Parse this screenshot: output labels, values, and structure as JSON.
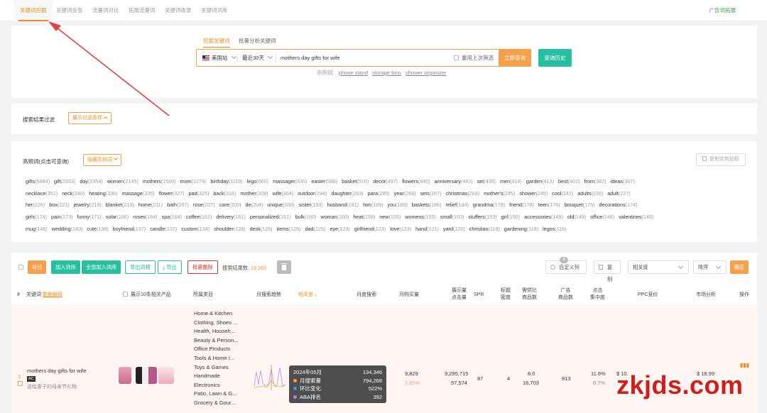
{
  "nav": {
    "tabs": [
      "关键词挖掘",
      "关键词反查",
      "流量词对比",
      "拓展流量词",
      "关键词收录",
      "关键词词库"
    ],
    "right_link": "广告词拓展"
  },
  "search": {
    "tabs": [
      "挖掘关键词",
      "批量分析关键词"
    ],
    "site": "美国站",
    "period": "最近30天",
    "query": "mothers day gifts for wife",
    "reuse_label": "重用上次筛选",
    "submit_label": "立即查询",
    "history_label": "查询历史",
    "examples_label": "示例词:",
    "examples": [
      "phone stand",
      "storage bins",
      "shower organizer"
    ]
  },
  "filter": {
    "title": "搜索结果过滤",
    "toggle_label": "展示过滤条件"
  },
  "keywords": {
    "title": "高频词(点击可查询)",
    "toggle_label": "隐藏高频词",
    "copy_label": "复制到剪贴板",
    "rows": [
      [
        [
          "gifts",
          "5684"
        ],
        [
          "gift",
          "2553"
        ],
        [
          "day",
          "2354"
        ],
        [
          "women",
          "2145"
        ],
        [
          "mothers",
          "1560"
        ],
        [
          "mom",
          "1279"
        ],
        [
          "birthday",
          "1119"
        ],
        [
          "lego",
          "660"
        ],
        [
          "massager",
          "635"
        ],
        [
          "easter",
          "588"
        ],
        [
          "basket",
          "516"
        ],
        [
          "decor",
          "497"
        ],
        [
          "flowers",
          "485"
        ],
        [
          "anniversary",
          "483"
        ],
        [
          "set",
          "439"
        ],
        [
          "men",
          "414"
        ],
        [
          "garden",
          "413"
        ],
        [
          "best",
          "402"
        ],
        [
          "from",
          "382"
        ],
        [
          "ideas",
          "367"
        ]
      ],
      [
        [
          "necklace",
          "351"
        ],
        [
          "neck",
          "340"
        ],
        [
          "heating",
          "336"
        ],
        [
          "massage",
          "335"
        ],
        [
          "flower",
          "327"
        ],
        [
          "pad",
          "325"
        ],
        [
          "back",
          "316"
        ],
        [
          "mother",
          "309"
        ],
        [
          "wife",
          "304"
        ],
        [
          "outdoor",
          "294"
        ],
        [
          "daughter",
          "293"
        ],
        [
          "para",
          "285"
        ],
        [
          "year",
          "269"
        ],
        [
          "sets",
          "267"
        ],
        [
          "christmas",
          "264"
        ],
        [
          "mother's",
          "245"
        ],
        [
          "shower",
          "245"
        ],
        [
          "cool",
          "242"
        ],
        [
          "adults",
          "230"
        ],
        [
          "adult",
          "227"
        ]
      ],
      [
        [
          "her",
          "225"
        ],
        [
          "box",
          "221"
        ],
        [
          "jewelry",
          "219"
        ],
        [
          "blanket",
          "213"
        ],
        [
          "home",
          "211"
        ],
        [
          "bath",
          "207"
        ],
        [
          "rose",
          "207"
        ],
        [
          "care",
          "205"
        ],
        [
          "de",
          "204"
        ],
        [
          "unique",
          "200"
        ],
        [
          "sister",
          "193"
        ],
        [
          "husband",
          "191"
        ],
        [
          "him",
          "189"
        ],
        [
          "you",
          "189"
        ],
        [
          "baskets",
          "186"
        ],
        [
          "relief",
          "184"
        ],
        [
          "grandma",
          "179"
        ],
        [
          "friend",
          "178"
        ],
        [
          "teen",
          "176"
        ],
        [
          "bouquet",
          "175"
        ],
        [
          "decorations",
          "174"
        ]
      ],
      [
        [
          "girls",
          "174"
        ],
        [
          "pain",
          "173"
        ],
        [
          "funny",
          "171"
        ],
        [
          "solar",
          "166"
        ],
        [
          "roses",
          "164"
        ],
        [
          "spa",
          "164"
        ],
        [
          "coffee",
          "161"
        ],
        [
          "delivery",
          "161"
        ],
        [
          "personalized",
          "161"
        ],
        [
          "bulk",
          "160"
        ],
        [
          "woman",
          "160"
        ],
        [
          "heat",
          "158"
        ],
        [
          "new",
          "155"
        ],
        [
          "womens",
          "155"
        ],
        [
          "small",
          "153"
        ],
        [
          "stuffers",
          "153"
        ],
        [
          "girl",
          "150"
        ],
        [
          "accessories",
          "149"
        ],
        [
          "old",
          "149"
        ],
        [
          "office",
          "148"
        ],
        [
          "valentines",
          "148"
        ]
      ],
      [
        [
          "mug",
          "146"
        ],
        [
          "wedding",
          "140"
        ],
        [
          "cute",
          "138"
        ],
        [
          "boyfriend",
          "137"
        ],
        [
          "candle",
          "137"
        ],
        [
          "custom",
          "134"
        ],
        [
          "shoulder",
          "128"
        ],
        [
          "desk",
          "126"
        ],
        [
          "items",
          "126"
        ],
        [
          "dad",
          "125"
        ],
        [
          "eye",
          "123"
        ],
        [
          "girlfriend",
          "123"
        ],
        [
          "love",
          "123"
        ],
        [
          "hand",
          "121"
        ],
        [
          "yard",
          "120"
        ],
        [
          "christian",
          "119"
        ],
        [
          "gardening",
          "118"
        ],
        [
          "legos",
          "116"
        ]
      ]
    ]
  },
  "results": {
    "toolbar": {
      "compare": "对比",
      "add": "加入词库",
      "add_all": "全部加入词库",
      "export_root": "导出词根",
      "export": "导出",
      "batch_delete": "批量删除",
      "count_label": "搜索结果数:",
      "count": "19,165",
      "custom_cols": "自定义列",
      "custom_badge": "4",
      "copy": "复制",
      "sort_field": "相关度",
      "sort_order": "降序",
      "confirm": "确定"
    },
    "headers": {
      "no": "#",
      "keyword": "关键词",
      "data_explain": "数据解释",
      "show_products": "展示10条相关产品",
      "category": "所属类目",
      "trend": "月搜索趋势",
      "relevance": "相关度",
      "monthly_search": "月度搜索",
      "monthly_buy": "月购买量",
      "impressions": "展示量",
      "clicks": "点击量",
      "spr": "SPR",
      "title_density1": "标题",
      "title_density2": "密度",
      "supply1": "需供比",
      "supply2": "商品数",
      "ad1": "广告",
      "ad2": "商品数",
      "click1": "点击",
      "click2": "集中度",
      "ppc": "PPC竞价",
      "market": "市场分析",
      "action": "操作"
    },
    "row": {
      "no": "1",
      "keyword": "mothers day gifts for wife",
      "ac_badge": "AC",
      "translation": "送给妻子的母亲节礼物",
      "categories": [
        "Home & Kitchen",
        "Clothing, Shoes ...",
        "Health, Househ...",
        "Beauty & Person...",
        "Office Products",
        "Tools & Home I...",
        "Toys & Games",
        "Handmade",
        "Electronics",
        "Patio, Lawn & G...",
        "Grocery & Gour..."
      ],
      "buy": "3,829",
      "buy_rate": "2.85%",
      "impressions": "3,295,715",
      "clicks": "57,574",
      "spr": "87",
      "title_density": "4",
      "supply_ratio": "8.0",
      "supply_products": "16,703",
      "ad_products": "813",
      "click_conc": "11.6%",
      "click_conc2": "6.7%",
      "ppc": "$ 10.",
      "market_price": "$ 18.99"
    },
    "tooltip": {
      "date": "2024年05月",
      "date_value": "134,346",
      "lines": [
        {
          "label": "月搜索量",
          "value": "794,268",
          "color": "#f5a623"
        },
        {
          "label": "环比变化",
          "value": "522%",
          "color": "#4a90e2"
        },
        {
          "label": "ABA排名",
          "value": "392",
          "color": "#9b8fe0"
        }
      ]
    }
  },
  "watermark": "zkjds.com"
}
